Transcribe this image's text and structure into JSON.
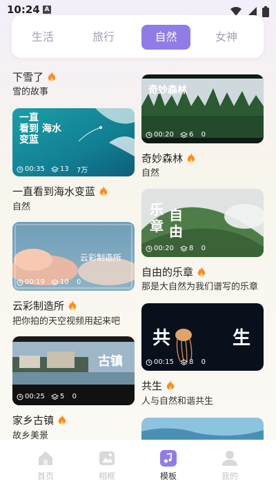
{
  "status": {
    "time": "10:24",
    "notification_glyph": "A"
  },
  "tabs": [
    {
      "label": "生活",
      "active": false
    },
    {
      "label": "旅行",
      "active": false
    },
    {
      "label": "自然",
      "active": true
    },
    {
      "label": "女神",
      "active": false
    }
  ],
  "colors": {
    "accent": "#8f7ce6",
    "fire": "#ff8a1e"
  },
  "left_column": [
    {
      "title": "下雪了",
      "subtitle": "雪的故事",
      "has_thumb": false
    },
    {
      "title": "一直看到海水变蓝",
      "subtitle": "自然",
      "duration": "00:35",
      "layers": "13",
      "count": "7万",
      "overlay": "一直\n看到 海水\n变蓝"
    },
    {
      "title": "云彩制造所",
      "subtitle": "把你拍的天空视频用起来吧",
      "duration": "00:19",
      "layers": "10",
      "count": "0",
      "overlay": "云彩制造所"
    },
    {
      "title": "家乡古镇",
      "subtitle": "故乡美景",
      "duration": "00:25",
      "layers": "5",
      "count": "0",
      "overlay": "古镇"
    }
  ],
  "right_column": [
    {
      "title": "奇妙森林",
      "subtitle": "自然",
      "duration": "00:20",
      "layers": "6",
      "count": "0",
      "overlay": "奇妙森林"
    },
    {
      "title": "自由的乐章",
      "subtitle": "那是大自然为我们谱写的乐章",
      "duration": "00:20",
      "layers": "8",
      "count": "0",
      "overlay1": "乐章",
      "overlay2": "自由"
    },
    {
      "title": "共生",
      "subtitle": "人与自然和谐共生",
      "duration": "00:15",
      "layers": "8",
      "count": "0",
      "overlay1": "共",
      "overlay2": "生"
    }
  ],
  "bottom_nav": [
    {
      "label": "首页",
      "icon": "home-icon",
      "active": false
    },
    {
      "label": "相框",
      "icon": "photo-frame-icon",
      "active": false
    },
    {
      "label": "模板",
      "icon": "music-note-icon",
      "active": true
    },
    {
      "label": "我的",
      "icon": "user-icon",
      "active": false
    }
  ]
}
